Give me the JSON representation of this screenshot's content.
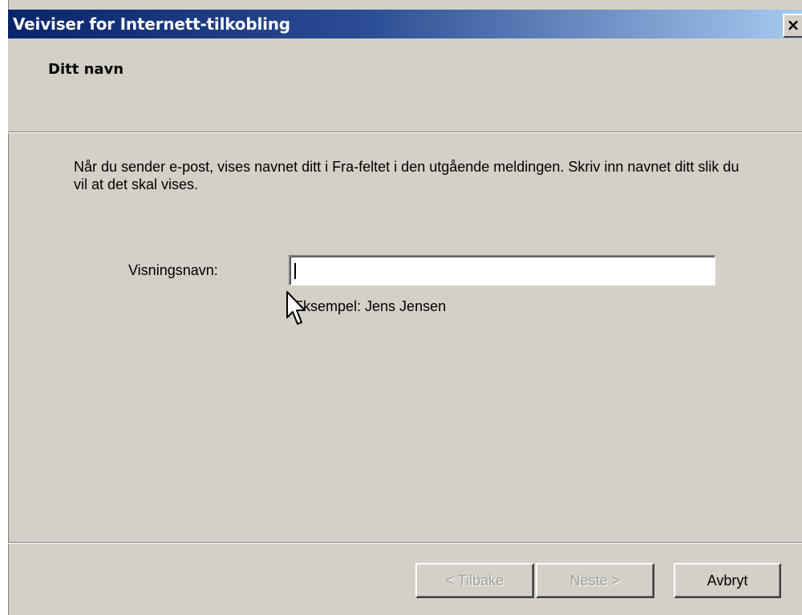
{
  "window": {
    "title": "Veiviser for Internett-tilkobling",
    "close_glyph": "×"
  },
  "header": {
    "title": "Ditt navn"
  },
  "content": {
    "description": "Når du sender e-post, vises navnet ditt i Fra-feltet i den utgående meldingen. Skriv inn navnet ditt slik du vil at det skal vises.",
    "display_name_label": "Visningsnavn:",
    "display_name_value": "",
    "example_text": "Eksempel: Jens Jensen"
  },
  "buttons": {
    "back_label": "< Tilbake",
    "next_label": "Neste >",
    "cancel_label": "Avbryt",
    "back_enabled": false,
    "next_enabled": false,
    "cancel_enabled": true
  },
  "colors": {
    "titlebar_start": "#0a246a",
    "titlebar_end": "#a6caf0",
    "face": "#d4d0c8"
  },
  "icons": {
    "close": "close-icon",
    "cursor": "mouse-pointer-icon"
  }
}
